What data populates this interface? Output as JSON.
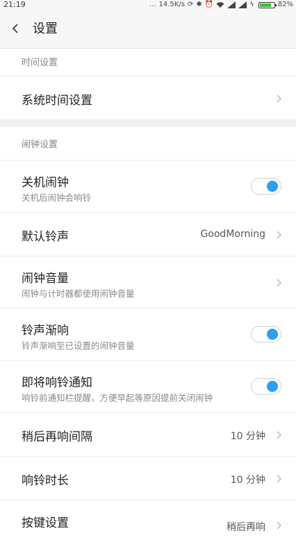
{
  "status_bar": {
    "time": "21:19",
    "dots": "...",
    "speed": "14.5K/s",
    "battery": "82%",
    "battery_level": 0.82,
    "icons": [
      "sync-icon",
      "bluetooth-icon",
      "alarm-icon",
      "wifi-icon",
      "signal-icon",
      "signal-icon",
      "charging-icon"
    ]
  },
  "header": {
    "title": "设置"
  },
  "sections": {
    "time": {
      "title": "时间设置",
      "items": {
        "system_time": {
          "label": "系统时间设置"
        }
      }
    },
    "alarm": {
      "title": "闹钟设置",
      "items": {
        "power_off_alarm": {
          "label": "关机闹钟",
          "sub": "关机后闹钟会响铃",
          "on": true
        },
        "default_ringtone": {
          "label": "默认铃声",
          "value": "GoodMorning"
        },
        "alarm_volume": {
          "label": "闹钟音量",
          "sub": "闹钟与计时器都使用闹钟音量"
        },
        "fade_in": {
          "label": "铃声渐响",
          "sub": "铃声渐响至已设置的闹钟音量",
          "on": true
        },
        "upcoming_notice": {
          "label": "即将响铃通知",
          "sub": "响铃前通知栏提醒，方便早起等原因提前关闭闹钟",
          "on": true
        },
        "snooze_interval": {
          "label": "稍后再响间隔",
          "value": "10 分钟"
        },
        "ring_duration": {
          "label": "响铃时长",
          "value": "10 分钟"
        },
        "key_settings": {
          "label": "按键设置",
          "value": "稍后再响"
        }
      }
    }
  },
  "colors": {
    "toggle_on": "#2e9ef1",
    "battery": "#3bbf3b",
    "header_bg": "#f7f7f7"
  }
}
